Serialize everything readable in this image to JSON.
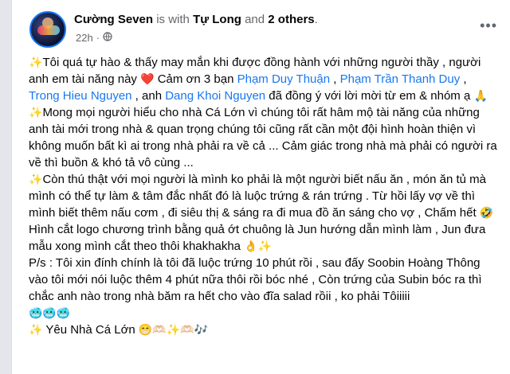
{
  "post": {
    "author": "Cường Seven",
    "with_text": " is with ",
    "tagged": "Tự Long",
    "and_text": " and ",
    "others": "2 others",
    "period": ".",
    "time": "22h",
    "dot": "·",
    "audience_icon": "globe-icon",
    "more_icon": "more-options-icon",
    "p1_a": "Tôi quá tự hào & thấy may mắn khi được đồng hành với những người thầy , người anh em tài năng này",
    "p1_b": " Cảm ơn 3 bạn ",
    "mention1": "Phạm Duy Thuận",
    "sep1": " , ",
    "mention2": "Phạm Trần Thanh Duy",
    "sep2": " , ",
    "mention3": "Trong Hieu Nguyen",
    "sep3": " ,  anh ",
    "mention4": "Dang Khoi Nguyen",
    "p1_c": " đã đồng ý với lời mời từ em & nhóm ạ",
    "p2": "Mong mọi người hiểu cho nhà Cá Lớn vì chúng tôi rất hâm mộ tài năng của những anh tài mới trong nhà & quan trọng chúng tôi cũng rất cần một đội hình hoàn thiện vì không muốn bất kì ai trong nhà phải ra về cả ... Cảm giác trong nhà mà phải có người ra về thì buồn & khó tả vô cùng ...",
    "p3": "Còn thú thật với mọi người là mình ko phải là một người biết nấu ăn , món ăn tủ mà mình có thể tự làm & tâm đắc nhất đó là luộc trứng & rán trứng . Từ hồi lấy vợ về thì mình biết thêm nấu cơm , đi siêu thị & sáng ra đi mua đồ ăn sáng cho vợ , Chấm hết",
    "p4": "Hình cắt logo chương trình bằng quả ớt chuông là Jun hướng dẫn mình làm , Jun đưa mẫu xong mình cắt theo thôi khakhakha",
    "p5": "P/s : Tôi xin đính chính là tôi đã luộc trứng 10 phút rồi , sau đấy Soobin Hoàng Thông vào tôi mới nói luộc thêm 4 phút nữa thôi rồi bóc nhé , Còn trứng của Subin bóc ra thì chắc anh nào trong nhà băm ra hết cho vào đĩa salad rồii , ko phải Tôiiiii",
    "p6": "Yêu Nhà Cá Lớn",
    "emoji": {
      "sparkles": "✨",
      "heart": "❤️",
      "pray": "🙏",
      "rofl": "🤣",
      "ok": "👌",
      "cold": "🥶🥶🥶",
      "tail": "😁🫶🏻✨🫶🏻🎶"
    },
    "link_color": "#1877f2"
  }
}
